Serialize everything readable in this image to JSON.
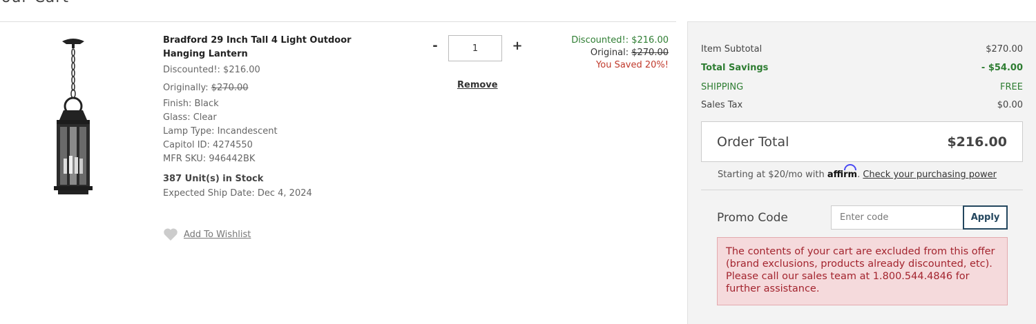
{
  "page": {
    "heading": "our Cart"
  },
  "item": {
    "title": "Bradford 29 Inch Tall 4 Light Outdoor Hanging Lantern",
    "discounted_label": "Discounted!: $216.00",
    "originally_prefix": "Originally: ",
    "originally_value": "$270.00",
    "finish": "Finish: Black",
    "glass": "Glass: Clear",
    "lamp_type": "Lamp Type: Incandescent",
    "capitol_id": "Capitol ID: 4274550",
    "mfr_sku": "MFR SKU: 946442BK",
    "stock": "387 Unit(s) in Stock",
    "ship_date": "Expected Ship Date: Dec 4, 2024",
    "wishlist_label": "Add To Wishlist"
  },
  "quantity": {
    "minus": "-",
    "value": "1",
    "plus": "+",
    "remove_label": "Remove"
  },
  "line_price": {
    "discounted": "Discounted!: $216.00",
    "original_prefix": "Original: ",
    "original_value": "$270.00",
    "saved": "You Saved 20%!"
  },
  "summary": {
    "subtotal_label": "Item Subtotal",
    "subtotal_value": "$270.00",
    "savings_label": "Total Savings",
    "savings_value": "- $54.00",
    "shipping_label": "SHIPPING",
    "shipping_value": "FREE",
    "tax_label": "Sales Tax",
    "tax_value": "$0.00",
    "order_total_label": "Order Total",
    "order_total_value": "$216.00",
    "affirm_prefix": "Starting at $20/mo with ",
    "affirm_logo": "affirm",
    "affirm_suffix": ". ",
    "affirm_link": "Check your purchasing power",
    "promo_label": "Promo Code",
    "promo_placeholder": "Enter code",
    "apply_label": "Apply",
    "promo_error": "The contents of your cart are excluded from this offer (brand exclusions, products already discounted, etc). Please call our sales team at 1.800.544.4846 for further assistance."
  },
  "colors": {
    "green": "#2e7d32",
    "red": "#c0392b",
    "apply_border": "#23465e",
    "error_bg": "#f5dadc"
  },
  "icons": [
    "hanging-lantern-product-image",
    "heart-icon",
    "affirm-logo"
  ]
}
